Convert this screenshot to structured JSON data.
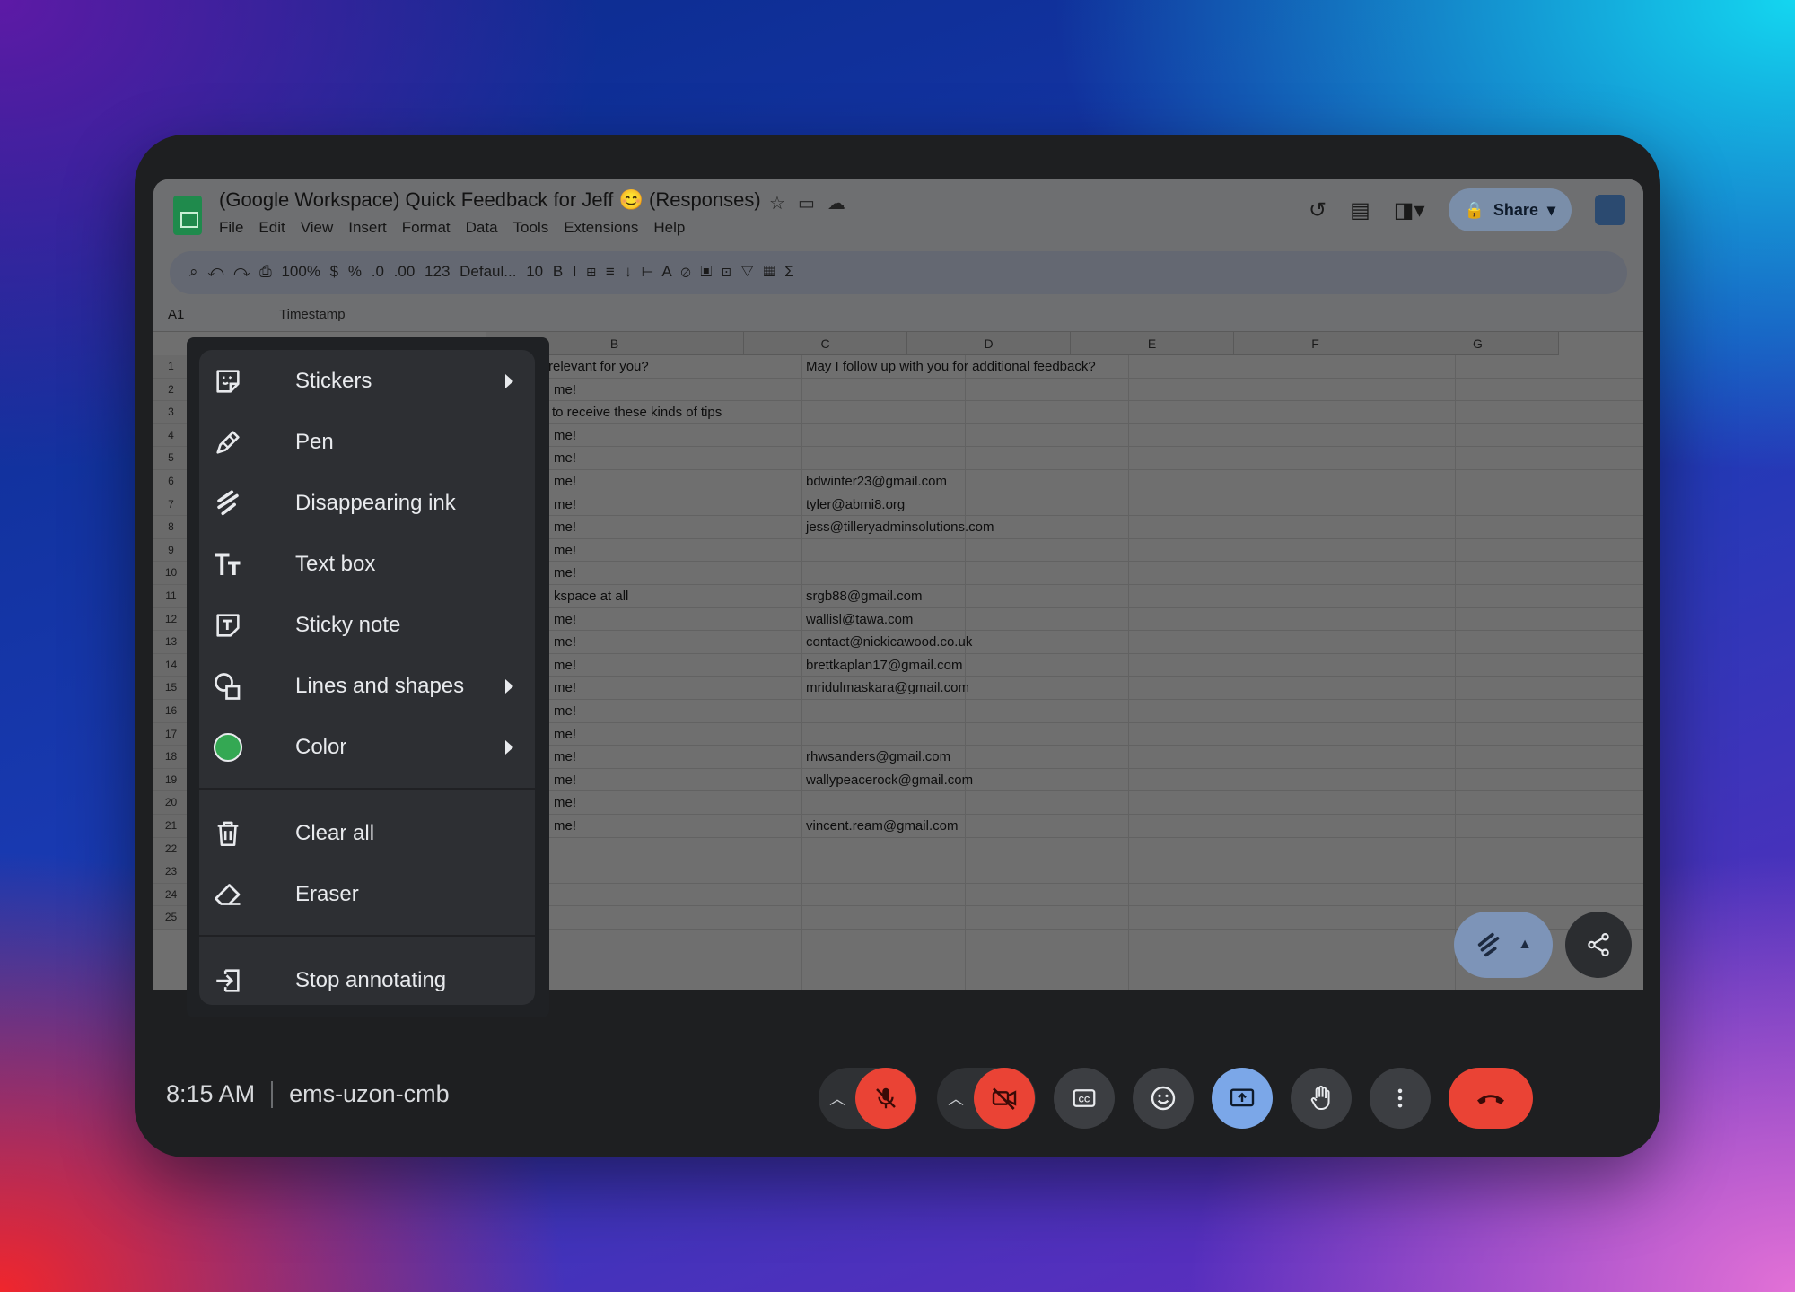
{
  "sheet": {
    "doc_title": "(Google Workspace) Quick Feedback for Jeff 😊 (Responses)",
    "menus": [
      "File",
      "Edit",
      "View",
      "Insert",
      "Format",
      "Data",
      "Tools",
      "Extensions",
      "Help"
    ],
    "share_label": "Share",
    "toolbar": {
      "zoom": "100%",
      "currency": "$",
      "percent": "%",
      "dec_decrease": ".0",
      "dec_increase": ".00",
      "number_format": "123",
      "font": "Defaul...",
      "font_size": "10",
      "bold": "B",
      "italic": "I"
    },
    "cell_ref": "A1",
    "formula_value": "Timestamp",
    "columns": [
      "B",
      "C",
      "D",
      "E",
      "F",
      "G"
    ],
    "header_b": "relevant for you?",
    "header_c": "May I follow up with you for additional feedback?",
    "rows": [
      {
        "num": "1",
        "b": "",
        "c": ""
      },
      {
        "num": "2",
        "b": "me!",
        "c": ""
      },
      {
        "num": "3",
        "b": "to receive these kinds of tips",
        "c": ""
      },
      {
        "num": "4",
        "b": "me!",
        "c": ""
      },
      {
        "num": "5",
        "b": "me!",
        "c": ""
      },
      {
        "num": "6",
        "b": "me!",
        "c": "bdwinter23@gmail.com"
      },
      {
        "num": "7",
        "b": "me!",
        "c": "tyler@abmi8.org"
      },
      {
        "num": "8",
        "b": "me!",
        "c": "jess@tilleryadminsolutions.com"
      },
      {
        "num": "9",
        "b": "me!",
        "c": ""
      },
      {
        "num": "10",
        "b": "me!",
        "c": ""
      },
      {
        "num": "11",
        "b": "kspace at all",
        "c": "srgb88@gmail.com"
      },
      {
        "num": "12",
        "b": "me!",
        "c": "wallisl@tawa.com"
      },
      {
        "num": "13",
        "b": "me!",
        "c": "contact@nickicawood.co.uk"
      },
      {
        "num": "14",
        "b": "me!",
        "c": "brettkaplan17@gmail.com"
      },
      {
        "num": "15",
        "b": "me!",
        "c": "mridulmaskara@gmail.com"
      },
      {
        "num": "16",
        "b": "me!",
        "c": ""
      },
      {
        "num": "17",
        "b": "me!",
        "c": ""
      },
      {
        "num": "18",
        "b": "me!",
        "c": "rhwsanders@gmail.com"
      },
      {
        "num": "19",
        "b": "me!",
        "c": "wallypeacerock@gmail.com"
      },
      {
        "num": "20",
        "b": "me!",
        "c": ""
      },
      {
        "num": "21",
        "b": "me!",
        "c": "vincent.ream@gmail.com"
      },
      {
        "num": "22",
        "b": "",
        "c": ""
      },
      {
        "num": "23",
        "b": "",
        "c": ""
      },
      {
        "num": "24",
        "b": "",
        "c": ""
      },
      {
        "num": "25",
        "b": "",
        "c": ""
      }
    ]
  },
  "annotate_menu": {
    "items": [
      {
        "label": "Stickers",
        "icon": "sticker-icon",
        "submenu": true
      },
      {
        "label": "Pen",
        "icon": "pen-icon",
        "submenu": false
      },
      {
        "label": "Disappearing ink",
        "icon": "disappearing-ink-icon",
        "submenu": false
      },
      {
        "label": "Text box",
        "icon": "text-box-icon",
        "submenu": false
      },
      {
        "label": "Sticky note",
        "icon": "sticky-note-icon",
        "submenu": false
      },
      {
        "label": "Lines and shapes",
        "icon": "shapes-icon",
        "submenu": true
      },
      {
        "label": "Color",
        "icon": "color-swatch-icon",
        "submenu": true
      },
      {
        "label": "Clear all",
        "icon": "trash-icon",
        "submenu": false
      },
      {
        "label": "Eraser",
        "icon": "eraser-icon",
        "submenu": false
      },
      {
        "label": "Stop annotating",
        "icon": "exit-icon",
        "submenu": false
      }
    ],
    "selected_color": "#34a853"
  },
  "call": {
    "time": "8:15 AM",
    "meeting_code": "ems-uzon-cmb",
    "controls": [
      "mic-off",
      "camera-off",
      "captions",
      "emoji",
      "present",
      "raise-hand",
      "more",
      "leave"
    ]
  },
  "colors": {
    "device": "#1e1f21",
    "menu_bg": "#2d2f33",
    "danger": "#ea4335",
    "present_active": "#7ba7e8"
  }
}
